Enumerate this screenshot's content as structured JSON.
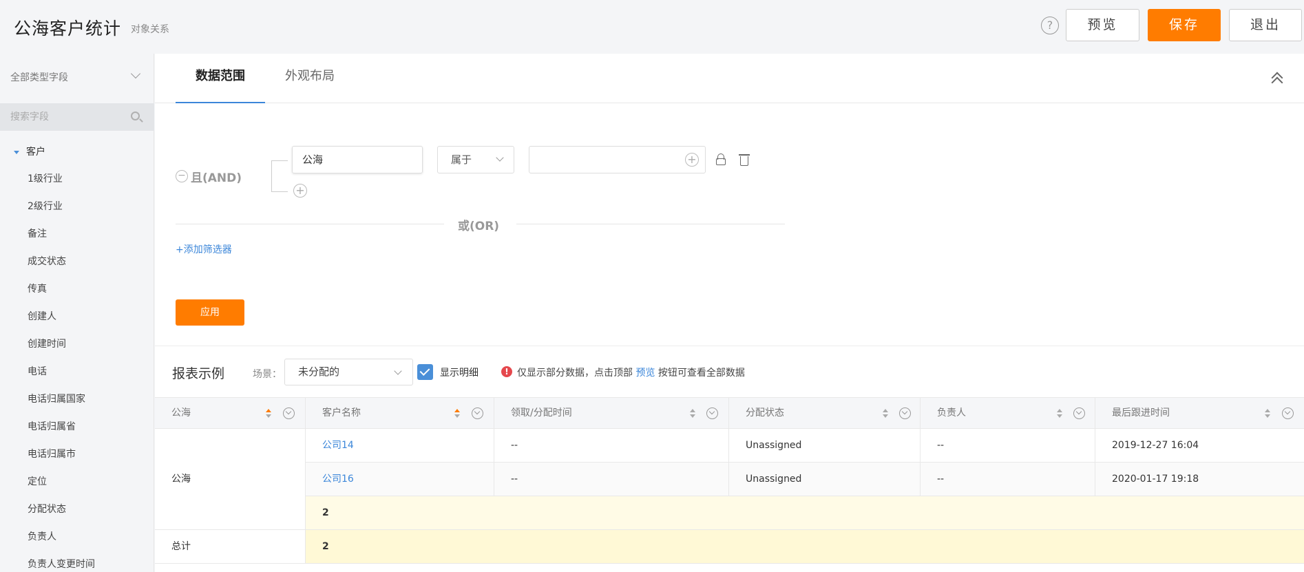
{
  "header": {
    "title": "公海客户统计",
    "subtitle": "对象关系",
    "help_label": "?",
    "preview_label": "预览",
    "save_label": "保存",
    "exit_label": "退出"
  },
  "sidebar": {
    "filter_label": "全部类型字段",
    "search_placeholder": "搜索字段",
    "root_label": "客户",
    "fields": [
      "1级行业",
      "2级行业",
      "备注",
      "成交状态",
      "传真",
      "创建人",
      "创建时间",
      "电话",
      "电话归属国家",
      "电话归属省",
      "电话归属市",
      "定位",
      "分配状态",
      "负责人",
      "负责人变更时间"
    ]
  },
  "tabs": {
    "data_range": "数据范围",
    "appearance": "外观布局"
  },
  "filter": {
    "minus_symbol": "−",
    "and_label": "且(AND)",
    "field_value": "公海",
    "operator": "属于",
    "plus_symbol": "+",
    "or_label": "或(OR)",
    "add_filter": "+添加筛选器",
    "apply_label": "应用"
  },
  "report": {
    "title": "报表示例",
    "scene_label": "场景：",
    "scene_value": "未分配的",
    "show_detail": "显示明细",
    "warn_symbol": "!",
    "notice_prefix": "仅显示部分数据，点击顶部",
    "notice_link": "预览",
    "notice_suffix": "按钮可查看全部数据"
  },
  "table": {
    "columns": [
      "公海",
      "客户名称",
      "领取/分配时间",
      "分配状态",
      "负责人",
      "最后跟进时间"
    ],
    "group_label": "公海",
    "rows": [
      {
        "name": "公司14",
        "claim_time": "--",
        "status": "Unassigned",
        "owner": "--",
        "last_follow": "2019-12-27 16:04"
      },
      {
        "name": "公司16",
        "claim_time": "--",
        "status": "Unassigned",
        "owner": "--",
        "last_follow": "2020-01-17 19:18"
      }
    ],
    "subtotal": "2",
    "total_label": "总计",
    "total_value": "2"
  }
}
